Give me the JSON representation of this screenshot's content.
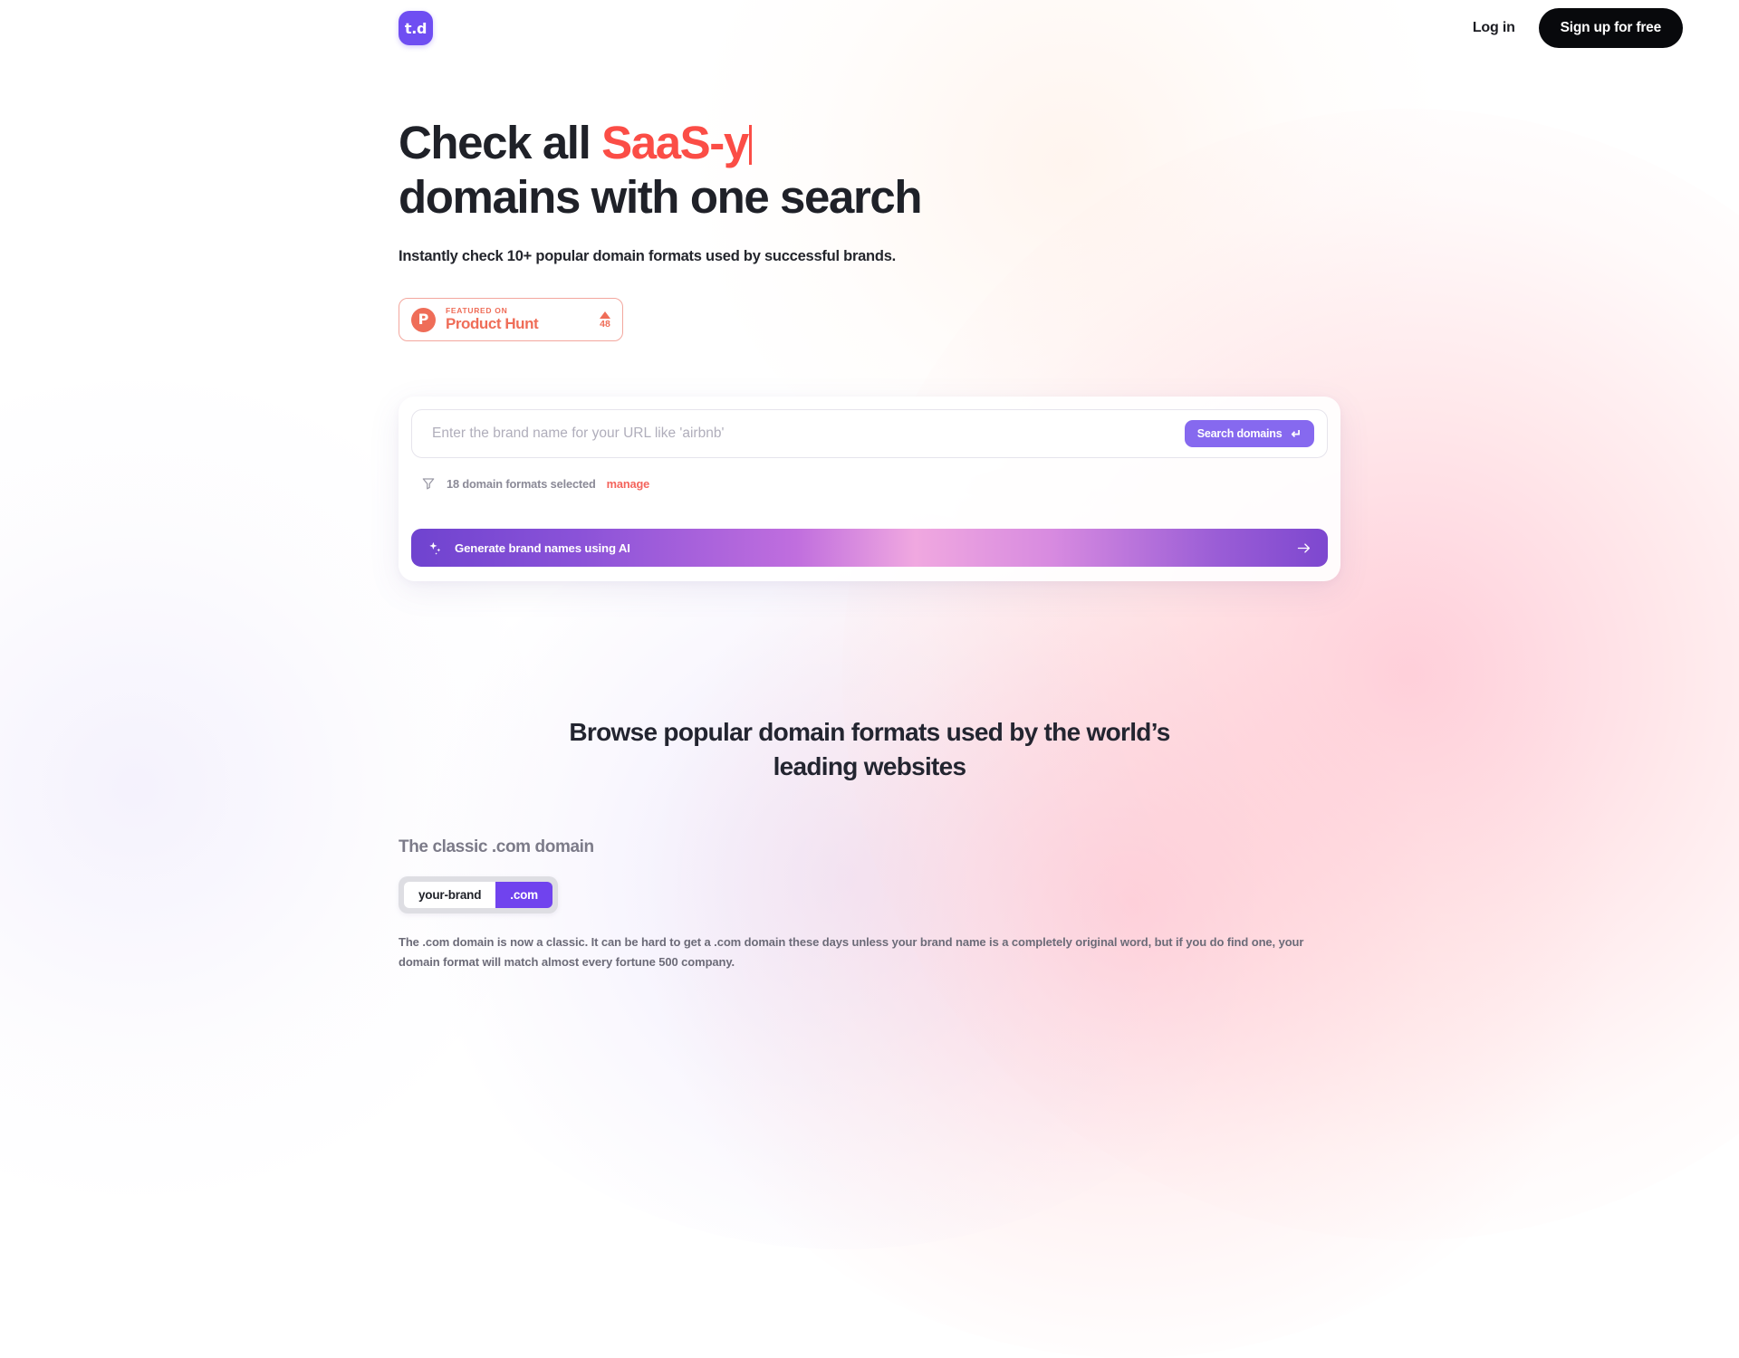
{
  "header": {
    "logo_text": "t.d",
    "login_label": "Log in",
    "signup_label": "Sign up for free"
  },
  "hero": {
    "headline_static_1": "Check all ",
    "headline_accent": "SaaS-y",
    "headline_line_2": "domains with one search",
    "subhead": "Instantly check 10+ popular domain formats used by successful brands.",
    "product_hunt": {
      "featured_label": "FEATURED ON",
      "name": "Product Hunt",
      "logo_letter": "P",
      "upvote_count": "48"
    }
  },
  "search": {
    "placeholder": "Enter the brand name for your URL like 'airbnb'",
    "value": "",
    "button_label": "Search domains",
    "enter_glyph": "↵",
    "filter_label": "18 domain formats selected",
    "manage_label": "manage",
    "ai_button_label": "Generate brand names using AI"
  },
  "browse": {
    "section_title_line_1": "Browse popular domain formats used by the world’s",
    "section_title_line_2": "leading websites",
    "format_title": "The classic .com domain",
    "chip_brand": "your-brand",
    "chip_tld": ".com",
    "format_body": "The .com domain is now a classic. It can be hard to get a .com domain these days unless your brand name is a completely original word, but if you do find one, your domain format will match almost every fortune 500 company."
  },
  "colors": {
    "brand_purple": "#6f4ef2",
    "accent_red": "#fb4d46",
    "product_hunt_orange": "#ef6d58",
    "search_button_purple": "#8669ef",
    "chip_purple": "#7043ee",
    "dark": "#08090c"
  }
}
